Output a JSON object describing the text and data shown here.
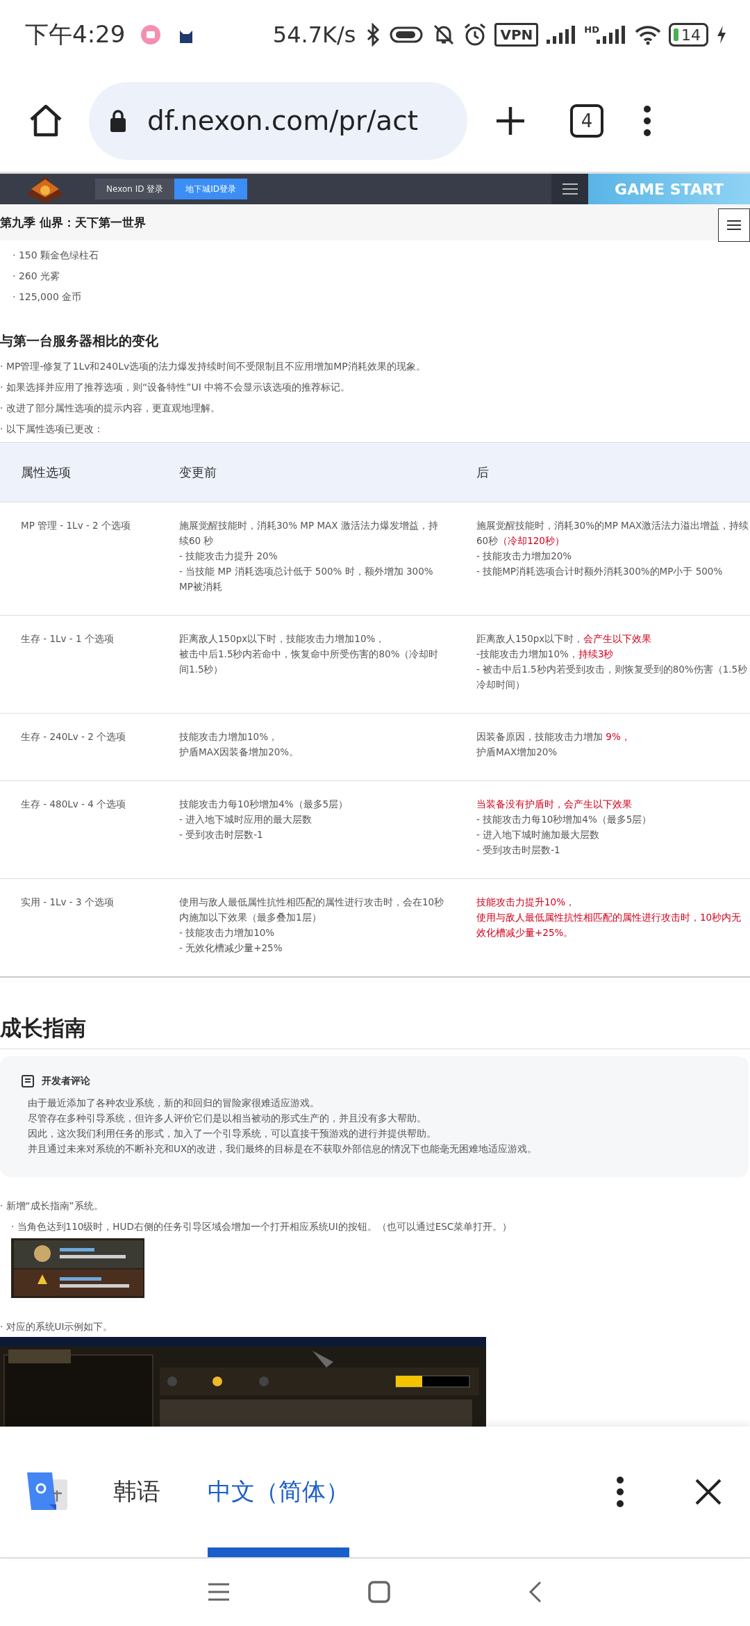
{
  "status_bar": {
    "time": "下午4:29",
    "network_speed": "54.7K/s",
    "vpn_label": "VPN",
    "signal_label": "HD",
    "battery": "14"
  },
  "browser": {
    "url": "df.nexon.com/pr/act",
    "tab_count": "4"
  },
  "site_header": {
    "login_buttons": [
      {
        "label": "Nexon ID 登录",
        "primary": false
      },
      {
        "label": "地下城ID登录",
        "primary": true
      }
    ],
    "game_start": "GAME START"
  },
  "page_title": "第九季 仙界：天下第一世界",
  "rewards": [
    "· 150 颗金色绿柱石",
    "· 260 光雾",
    "· 125,000 金币"
  ],
  "changes": {
    "heading": "与第一台服务器相比的变化",
    "bullets": [
      "· MP管理-修复了1Lv和240Lv选项的法力爆发持续时间不受限制且不应用增加MP消耗效果的现象。",
      "· 如果选择并应用了推荐选项，则“设备特性”UI 中将不会显示该选项的推荐标记。",
      "· 改进了部分属性选项的提示内容，更直观地理解。",
      "· 以下属性选项已更改："
    ],
    "table": {
      "columns": [
        "属性选项",
        "变更前",
        "后"
      ],
      "rows": [
        {
          "option": "MP 管理 - 1Lv - 2 个选项",
          "before": [
            [
              {
                "text": "施展觉醒技能时，消耗30% MP MAX 激活法力爆发增益，持续60 秒",
                "highlight": false
              }
            ],
            [
              {
                "text": "- 技能攻击力提升 20%",
                "highlight": false
              }
            ],
            [
              {
                "text": "- 当技能 MP 消耗选项总计低于 500% 时，额外增加 300% MP被消耗",
                "highlight": false
              }
            ]
          ],
          "after": [
            [
              {
                "text": "施展觉醒技能时，消耗30%的MP MAX激活法力溢出增益，持续60秒",
                "highlight": false
              },
              {
                "text": "（冷却120秒）",
                "highlight": true
              }
            ],
            [
              {
                "text": "- 技能攻击力增加20%",
                "highlight": false
              }
            ],
            [
              {
                "text": "- 技能MP消耗选项合计时额外消耗300%的MP小于 500%",
                "highlight": false
              }
            ]
          ]
        },
        {
          "option": "生存 - 1Lv - 1 个选项",
          "before": [
            [
              {
                "text": "距离敌人150px以下时，技能攻击力增加10%，",
                "highlight": false
              }
            ],
            [
              {
                "text": "被击中后1.5秒内若命中，恢复命中所受伤害的80%（冷却时间1.5秒）",
                "highlight": false
              }
            ]
          ],
          "after": [
            [
              {
                "text": "距离敌人150px以下时，",
                "highlight": false
              },
              {
                "text": "会产生以下效果",
                "highlight": true
              }
            ],
            [
              {
                "text": "-技能攻击力增加10%，",
                "highlight": false
              },
              {
                "text": "持续3秒",
                "highlight": true
              }
            ],
            [
              {
                "text": "- 被击中后1.5秒内若受到攻击，则恢复受到的80%伤害（1.5秒冷却时间）",
                "highlight": false
              }
            ]
          ]
        },
        {
          "option": "生存 - 240Lv - 2 个选项",
          "before": [
            [
              {
                "text": "技能攻击力增加10%，",
                "highlight": false
              }
            ],
            [
              {
                "text": "护盾MAX因装备增加20%。",
                "highlight": false
              }
            ]
          ],
          "after": [
            [
              {
                "text": "因装备原因，技能攻击力增加 ",
                "highlight": false
              },
              {
                "text": "9%，",
                "highlight": true
              }
            ],
            [
              {
                "text": "护盾MAX增加20%",
                "highlight": false
              }
            ]
          ]
        },
        {
          "option": "生存 - 480Lv - 4 个选项",
          "before": [
            [
              {
                "text": "技能攻击力每10秒增加4%（最多5层）",
                "highlight": false
              }
            ],
            [
              {
                "text": "- 进入地下城时应用的最大层数",
                "highlight": false
              }
            ],
            [
              {
                "text": "- 受到攻击时层数-1",
                "highlight": false
              }
            ]
          ],
          "after": [
            [
              {
                "text": "当装备没有护盾时，会产生以下效果",
                "highlight": true
              }
            ],
            [
              {
                "text": "- 技能攻击力每10秒增加4%（最多5层）",
                "highlight": false
              }
            ],
            [
              {
                "text": "- 进入地下城时施加最大层数",
                "highlight": false
              }
            ],
            [
              {
                "text": "- 受到攻击时层数-1",
                "highlight": false
              }
            ]
          ]
        },
        {
          "option": "实用 - 1Lv - 3 个选项",
          "before": [
            [
              {
                "text": "使用与敌人最低属性抗性相匹配的属性进行攻击时，会在10秒内施加以下效果（最多叠加1层）",
                "highlight": false
              }
            ],
            [
              {
                "text": "- 技能攻击力增加10%",
                "highlight": false
              }
            ],
            [
              {
                "text": "- 无效化槽减少量+25%",
                "highlight": false
              }
            ]
          ],
          "after": [
            [
              {
                "text": "技能攻击力提升10%，",
                "highlight": true
              }
            ],
            [
              {
                "text": "使用与敌人最低属性抗性相匹配的属性进行攻击时，10秒内无效化槽减少量+25%。",
                "highlight": true
              }
            ]
          ]
        }
      ]
    }
  },
  "growth": {
    "heading": "成长指南",
    "comment": {
      "title": "开发者评论",
      "lines": [
        "由于最近添加了各种农业系统，新的和回归的冒险家很难适应游戏。",
        "尽管存在多种引导系统，但许多人评价它们是以相当被动的形式生产的，并且没有多大帮助。",
        "因此，这次我们利用任务的形式，加入了一个引导系统，可以直接干预游戏的进行并提供帮助。",
        "并且通过未来对系统的不断补充和UX的改进，我们最终的目标是在不获取外部信息的情况下也能毫无困难地适应游戏。"
      ]
    },
    "items": [
      {
        "kind": "text",
        "text": "· 新增“成长指南”系统。"
      },
      {
        "kind": "subtext",
        "text": "· 当角色达到110级时，HUD右侧的任务引导区域会增加一个打开相应系统UI的按钮。（也可以通过ESC菜单打开。）"
      },
      {
        "kind": "thumbnail"
      },
      {
        "kind": "text",
        "text": "· 对应的系统UI示例如下。"
      },
      {
        "kind": "screenshot"
      }
    ]
  },
  "translate_bar": {
    "languages": [
      {
        "label": "韩语",
        "selected": false
      },
      {
        "label": "中文（简体）",
        "selected": true
      }
    ]
  }
}
